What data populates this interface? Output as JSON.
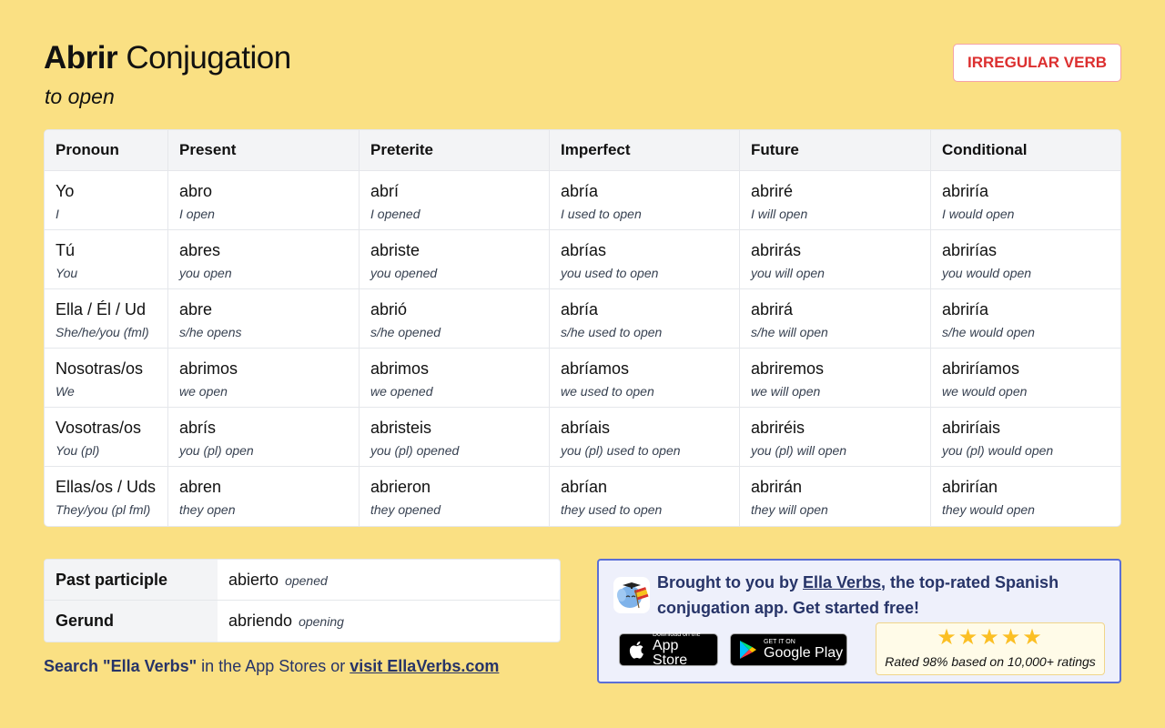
{
  "header": {
    "verb": "Abrir",
    "title_suffix": "Conjugation",
    "translation": "to open",
    "badge": "IRREGULAR VERB"
  },
  "table": {
    "headers": [
      "Pronoun",
      "Present",
      "Preterite",
      "Imperfect",
      "Future",
      "Conditional"
    ],
    "rows": [
      {
        "pronoun": "Yo",
        "pronoun_en": "I",
        "cells": [
          {
            "form": "abro",
            "en": "I open"
          },
          {
            "form": "abrí",
            "en": "I opened"
          },
          {
            "form": "abría",
            "en": "I used to open"
          },
          {
            "form": "abriré",
            "en": "I will open"
          },
          {
            "form": "abriría",
            "en": "I would open"
          }
        ]
      },
      {
        "pronoun": "Tú",
        "pronoun_en": "You",
        "cells": [
          {
            "form": "abres",
            "en": "you open"
          },
          {
            "form": "abriste",
            "en": "you opened"
          },
          {
            "form": "abrías",
            "en": "you used to open"
          },
          {
            "form": "abrirás",
            "en": "you will open"
          },
          {
            "form": "abrirías",
            "en": "you would open"
          }
        ]
      },
      {
        "pronoun": "Ella / Él / Ud",
        "pronoun_en": "She/he/you (fml)",
        "cells": [
          {
            "form": "abre",
            "en": "s/he opens"
          },
          {
            "form": "abrió",
            "en": "s/he opened"
          },
          {
            "form": "abría",
            "en": "s/he used to open"
          },
          {
            "form": "abrirá",
            "en": "s/he will open"
          },
          {
            "form": "abriría",
            "en": "s/he would open"
          }
        ]
      },
      {
        "pronoun": "Nosotras/os",
        "pronoun_en": "We",
        "cells": [
          {
            "form": "abrimos",
            "en": "we open"
          },
          {
            "form": "abrimos",
            "en": "we opened"
          },
          {
            "form": "abríamos",
            "en": "we used to open"
          },
          {
            "form": "abriremos",
            "en": "we will open"
          },
          {
            "form": "abriríamos",
            "en": "we would open"
          }
        ]
      },
      {
        "pronoun": "Vosotras/os",
        "pronoun_en": "You (pl)",
        "cells": [
          {
            "form": "abrís",
            "en": "you (pl) open"
          },
          {
            "form": "abristeis",
            "en": "you (pl) opened"
          },
          {
            "form": "abríais",
            "en": "you (pl) used to open"
          },
          {
            "form": "abriréis",
            "en": "you (pl) will open"
          },
          {
            "form": "abriríais",
            "en": "you (pl) would open"
          }
        ]
      },
      {
        "pronoun": "Ellas/os / Uds",
        "pronoun_en": "They/you (pl fml)",
        "cells": [
          {
            "form": "abren",
            "en": "they open"
          },
          {
            "form": "abrieron",
            "en": "they opened"
          },
          {
            "form": "abrían",
            "en": "they used to open"
          },
          {
            "form": "abrirán",
            "en": "they will open"
          },
          {
            "form": "abrirían",
            "en": "they would open"
          }
        ]
      }
    ]
  },
  "extra": {
    "past_participle": {
      "label": "Past participle",
      "form": "abierto",
      "en": "opened"
    },
    "gerund": {
      "label": "Gerund",
      "form": "abriendo",
      "en": "opening"
    }
  },
  "footer": {
    "search_bold": "Search \"Ella Verbs\"",
    "search_mid": " in the App Stores or ",
    "link": "visit EllaVerbs.com"
  },
  "promo": {
    "text_pre": "Brought to you by ",
    "link": "Ella Verbs",
    "text_post": ", the top-rated Spanish conjugation app. Get started free!",
    "appstore_small": "Download on the",
    "appstore_big": "App Store",
    "gplay_small": "GET IT ON",
    "gplay_big": "Google Play",
    "stars": "★★★★★",
    "rating_value": 5,
    "rating_text": "Rated 98% based on 10,000+ ratings",
    "accent": "#5b6fd6"
  }
}
